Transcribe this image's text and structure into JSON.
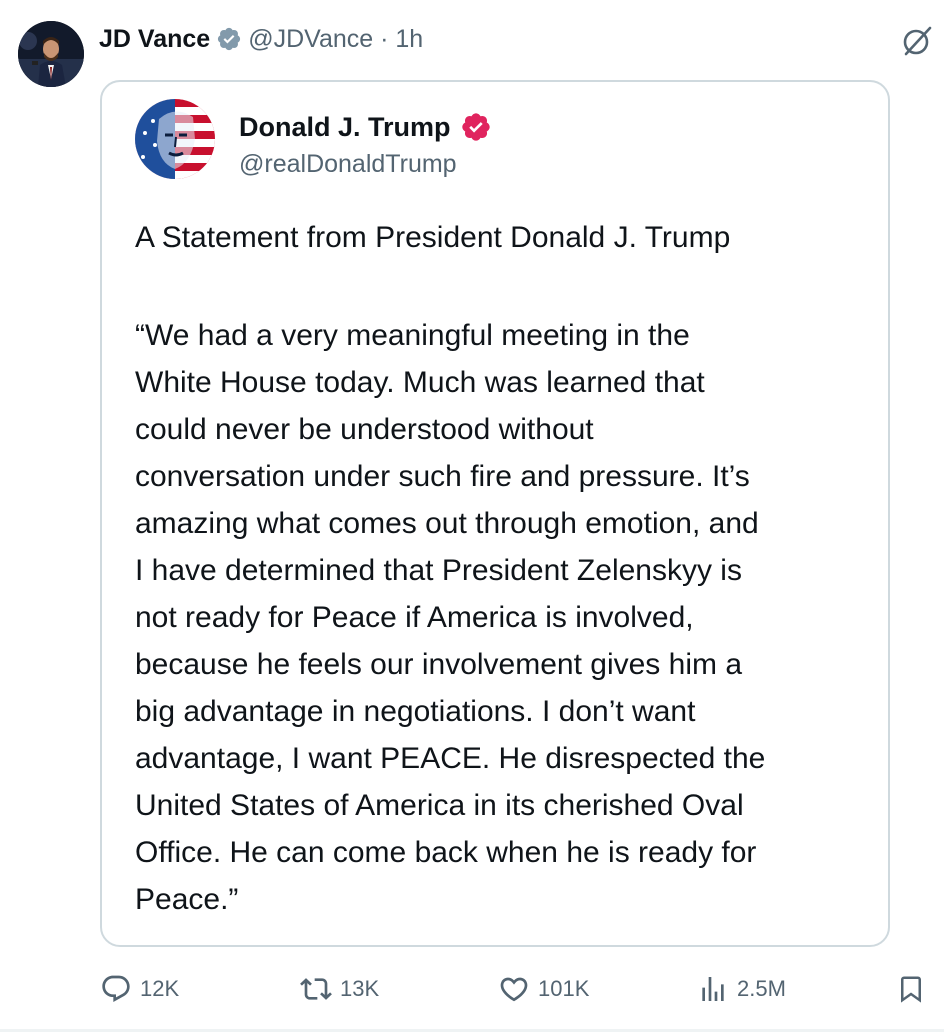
{
  "post": {
    "author_name": "JD Vance",
    "author_handle": "@JDVance",
    "separator": "·",
    "time_ago": "1h",
    "verified_icon": "verified-badge-icon",
    "top_right_icon": "grok-icon"
  },
  "quote": {
    "author_name": "Donald J. Trump",
    "author_handle": "@realDonaldTrump",
    "badge_color": "#e0245e",
    "title": "A Statement from President Donald J. Trump",
    "body_lines": [
      "“We had a very meaningful meeting in the",
      "White House today. Much was learned that",
      "could never be understood without",
      "conversation under such fire and pressure. It’s",
      "amazing what comes out through emotion, and",
      "I have determined that President Zelenskyy is",
      "not ready for Peace if America is involved,",
      "because he feels our involvement gives him a",
      "big advantage in negotiations. I don’t want",
      "advantage, I want PEACE. He disrespected the",
      "United States of America in its cherished Oval",
      "Office. He can come back when he is ready for",
      "Peace.”"
    ]
  },
  "actions": {
    "replies": "12K",
    "reposts": "13K",
    "likes": "101K",
    "views": "2.5M"
  },
  "colors": {
    "text": "#0f1419",
    "secondary": "#536471",
    "border": "#cfd9de",
    "verified_blue": "#1d9bf0"
  }
}
